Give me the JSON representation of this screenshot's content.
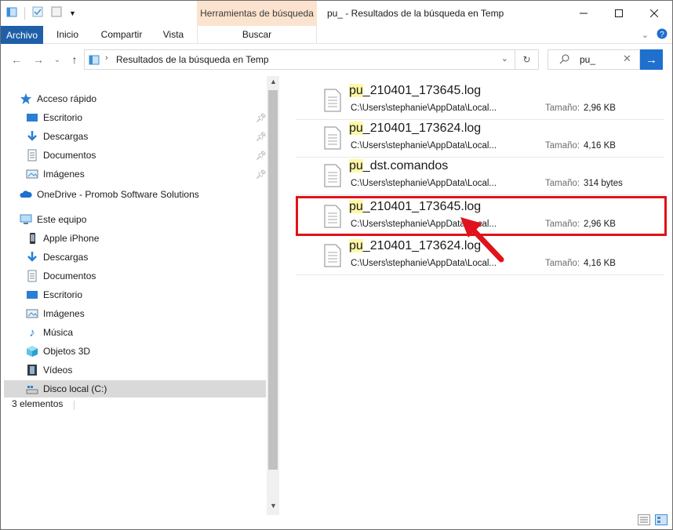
{
  "titlebar": {
    "context_tab": "Herramientas de búsqueda",
    "title": "pu_ - Resultados de la búsqueda en Temp"
  },
  "ribbon": {
    "tabs": [
      "Archivo",
      "Inicio",
      "Compartir",
      "Vista",
      "Buscar"
    ]
  },
  "address": {
    "path": "Resultados de la búsqueda en Temp",
    "search_value": "pu_"
  },
  "nav": {
    "quick_access": "Acceso rápido",
    "quick_items": [
      "Escritorio",
      "Descargas",
      "Documentos",
      "Imágenes"
    ],
    "onedrive": "OneDrive - Promob Software Solutions",
    "this_pc": "Este equipo",
    "pc_items": [
      "Apple iPhone",
      "Descargas",
      "Documentos",
      "Escritorio",
      "Imágenes",
      "Música",
      "Objetos 3D",
      "Vídeos",
      "Disco local (C:)"
    ]
  },
  "status": {
    "count": "3 elementos"
  },
  "results": [
    {
      "highlight": "pu",
      "rest": "_210401_173645.log",
      "path": "C:\\Users\\stephanie\\AppData\\Local...",
      "size_label": "Tamaño:",
      "size": "2,96 KB"
    },
    {
      "highlight": "pu",
      "rest": "_210401_173624.log",
      "path": "C:\\Users\\stephanie\\AppData\\Local...",
      "size_label": "Tamaño:",
      "size": "4,16 KB"
    },
    {
      "highlight": "pu",
      "rest": "_dst.comandos",
      "path": "C:\\Users\\stephanie\\AppData\\Local...",
      "size_label": "Tamaño:",
      "size": "314 bytes"
    },
    {
      "highlight": "pu",
      "rest": "_210401_173645.log",
      "path": "C:\\Users\\stephanie\\AppData\\Local...",
      "size_label": "Tamaño:",
      "size": "2,96 KB"
    },
    {
      "highlight": "pu",
      "rest": "_210401_173624.log",
      "path": "C:\\Users\\stephanie\\AppData\\Local...",
      "size_label": "Tamaño:",
      "size": "4,16 KB"
    }
  ],
  "colors": {
    "accent": "#1f6fcf",
    "file_tab": "#1f5fa8",
    "context_tab": "#fbe3cf",
    "highlight": "#fff7a6",
    "annotation": "#e0121b"
  }
}
